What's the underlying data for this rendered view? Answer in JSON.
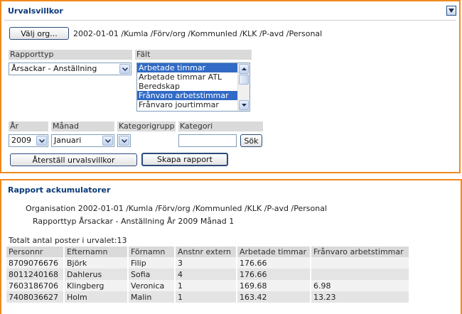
{
  "filter": {
    "title": "Urvalsvillkor",
    "choose_org_label": "Välj org...",
    "org_path": "2002-01-01 /Kumla /Förv/org /Kommunled /KLK /P-avd /Personal",
    "report_type_header": "Rapporttyp",
    "report_type_value": "Årsackar - Anställning",
    "field_header": "Fält",
    "field_options": [
      {
        "label": "Arbetade timmar",
        "selected": true
      },
      {
        "label": "Arbetade timmar ATL",
        "selected": false
      },
      {
        "label": "Beredskap",
        "selected": false
      },
      {
        "label": "Frånvaro arbetstimmar",
        "selected": true
      },
      {
        "label": "Frånvaro jourtimmar",
        "selected": false
      }
    ],
    "year_header": "År",
    "year_value": "2009",
    "month_header": "Månad",
    "month_value": "Januari",
    "category_group_header": "Kategorigrupp",
    "category_group_value": "",
    "category_header": "Kategori",
    "category_value": "",
    "search_label": "Sök",
    "reset_label": "Återställ urvalsvillkor",
    "create_label": "Skapa rapport"
  },
  "report": {
    "title": "Rapport ackumulatorer",
    "org_line": "Organisation 2002-01-01 /Kumla /Förv/org /Kommunled /KLK /P-avd /Personal",
    "type_line": "Rapporttyp Årsackar - Anställning År 2009 Månad 1",
    "total_line": "Totalt antal poster i urvalet:13",
    "columns": [
      "Personnr",
      "Efternamn",
      "Förnamn",
      "Anstnr extern",
      "Arbetade timmar",
      "Frånvaro arbetstimmar"
    ],
    "rows": [
      [
        "8709076676",
        "Björk",
        "Filip",
        "3",
        "176.66",
        ""
      ],
      [
        "8011240168",
        "Dahlerus",
        "Sofia",
        "4",
        "176.66",
        ""
      ],
      [
        "7603186706",
        "Klingberg",
        "Veronica",
        "1",
        "169.68",
        "6.98"
      ],
      [
        "7408036627",
        "Holm",
        "Malin",
        "1",
        "163.42",
        "13.23"
      ]
    ]
  },
  "icons": {
    "collapse": "triangle-down-icon",
    "dropdown": "chevron-down-icon",
    "scroll_up": "arrow-up-icon",
    "scroll_down": "arrow-down-icon"
  },
  "colors": {
    "panel_border": "#f08a1f",
    "title": "#0b3a79",
    "selection": "#316ac5"
  }
}
